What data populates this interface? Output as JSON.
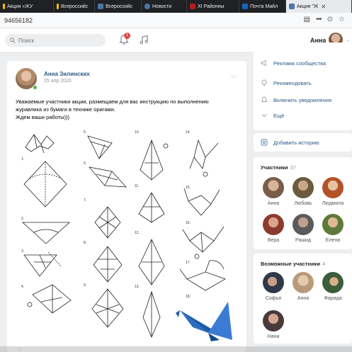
{
  "browser": {
    "tabs": [
      {
        "label": "Акция «ЖУ",
        "color": "#f2c200"
      },
      {
        "label": "Всероссийс",
        "color": "#f2c200"
      },
      {
        "label": "Всероссийс",
        "color": "#4a76a8"
      },
      {
        "label": "Новости",
        "color": "#4a76a8"
      },
      {
        "label": "XI Районны",
        "color": "#b71c1c"
      },
      {
        "label": "Почта Майл",
        "color": "#1565c0"
      },
      {
        "label": "Акция \"Ж",
        "color": "#4a76a8"
      }
    ],
    "active_tab_index": 6,
    "url": "94656182",
    "icons": [
      "reader-icon",
      "more-icon",
      "pocket-icon",
      "star-icon"
    ]
  },
  "header": {
    "search_placeholder": "Поиск",
    "notification_count": "1",
    "user_name": "Анна"
  },
  "post": {
    "author": "Анна Зилинских",
    "date": "25 апр 2020",
    "text_line1": "Уважаемые участники акции, размещаем для вас инструкцию по выполнению",
    "text_line2": "журавлика из бумаги в технике оригами.",
    "text_line3": "Ждем ваши работы)))",
    "steps": [
      "1.",
      "2.",
      "3.",
      "4.",
      "5.",
      "6.",
      "7.",
      "8.",
      "9.",
      "10.",
      "11.",
      "12.",
      "13.",
      "14.",
      "15.",
      "16.",
      "17.",
      "18."
    ]
  },
  "menu": {
    "items": [
      {
        "label": "Реклама сообщества",
        "icon": "megaphone-icon"
      },
      {
        "label": "Рекомендовать",
        "icon": "lightbulb-icon"
      },
      {
        "label": "Включить уведомления",
        "icon": "bell-icon"
      },
      {
        "label": "Ещё",
        "icon": "chevron-down-icon"
      }
    ],
    "story_label": "Добавить историю"
  },
  "participants": {
    "title": "Участники",
    "count": "37",
    "people": [
      {
        "name": "Анна",
        "color": "#7a5c4a"
      },
      {
        "name": "Любовь",
        "color": "#6b5a3e"
      },
      {
        "name": "Людмила",
        "color": "#b5522a"
      },
      {
        "name": "Вера",
        "color": "#8a3b2e"
      },
      {
        "name": "Рашид",
        "color": "#5a5a5a"
      },
      {
        "name": "Елена",
        "color": "#5c7a3a"
      }
    ]
  },
  "possible": {
    "title": "Возможные участники",
    "count": "4",
    "people": [
      {
        "name": "Софья",
        "color": "#2e3a4a"
      },
      {
        "name": "Анна",
        "color": "#b89a7a"
      },
      {
        "name": "Фарида",
        "color": "#3b5e3a"
      },
      {
        "name": "Нани",
        "color": "#4a3a3a"
      }
    ]
  }
}
